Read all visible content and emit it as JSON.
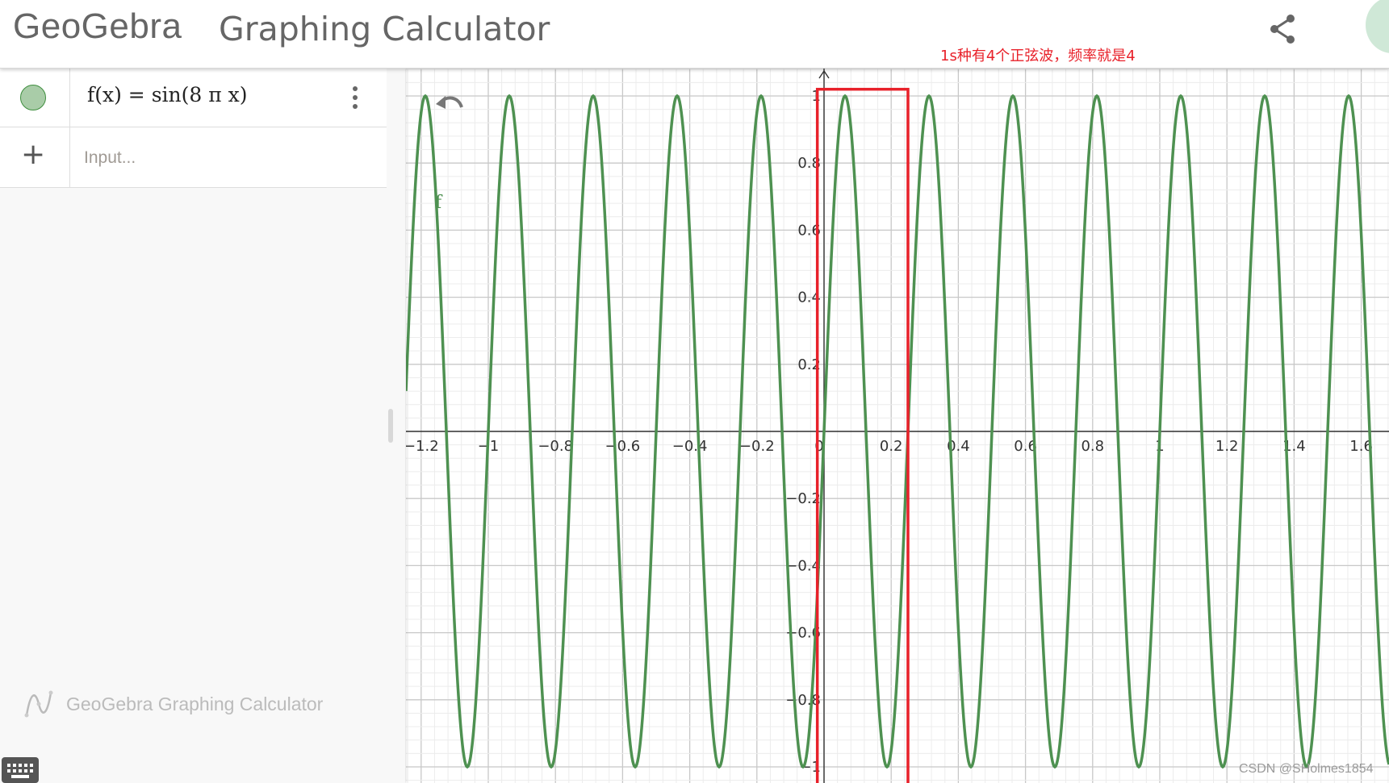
{
  "header": {
    "logo_text": "GeoGebra",
    "app_title": "Graphing Calculator",
    "share_icon": "share-icon",
    "help_icon": "help-icon"
  },
  "annotation": {
    "text": "1s种有4个正弦波，频率就是4",
    "color": "#e8212a"
  },
  "algebra": {
    "items": [
      {
        "expression": "f(x) = sin(8 π x)",
        "color": "#3f8f3f",
        "visible": true
      }
    ],
    "input_placeholder": "Input...",
    "brand_label": "GeoGebra Graphing Calculator"
  },
  "graph": {
    "function_label": "f",
    "function": "sin(8πx)",
    "curve_color": "#4e9151",
    "highlight_box": {
      "x_from": -0.02,
      "x_to": 0.25,
      "y_top": 1.02,
      "color": "#e8212a"
    },
    "x_ticks": [
      "−1.2",
      "−1",
      "−0.8",
      "−0.6",
      "−0.4",
      "−0.2",
      "0",
      "0.2",
      "0.4",
      "0.6",
      "0.8",
      "1",
      "1.2",
      "1.4",
      "1.6"
    ],
    "x_tick_values": [
      -1.2,
      -1,
      -0.8,
      -0.6,
      -0.4,
      -0.2,
      0,
      0.2,
      0.4,
      0.6,
      0.8,
      1,
      1.2,
      1.4,
      1.6
    ],
    "y_ticks": [
      "1",
      "0.8",
      "0.6",
      "0.4",
      "0.2",
      "−0.2",
      "−0.4",
      "−0.6",
      "−0.8",
      "−1"
    ],
    "y_tick_values": [
      1,
      0.8,
      0.6,
      0.4,
      0.2,
      -0.2,
      -0.4,
      -0.6,
      -0.8,
      -1
    ],
    "grid": true
  },
  "watermark": "CSDN @SHolmes1854"
}
